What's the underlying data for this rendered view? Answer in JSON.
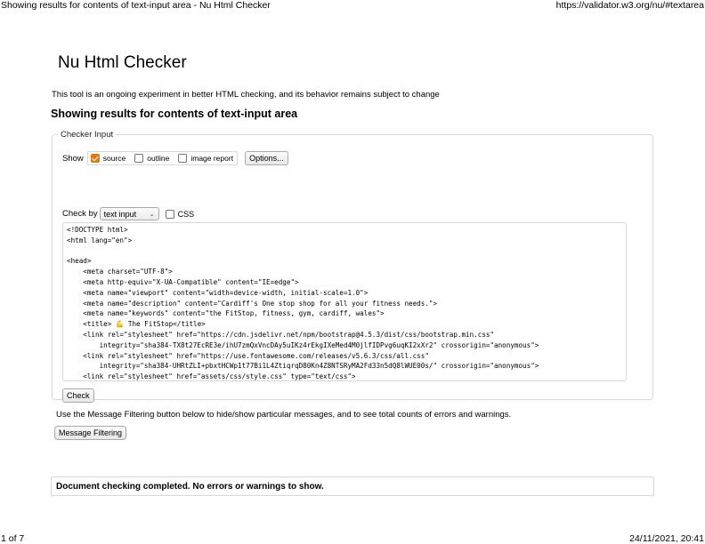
{
  "print_header": {
    "title": "Showing results for contents of text-input area - Nu Html Checker",
    "url": "https://validator.w3.org/nu/#textarea"
  },
  "print_footer": {
    "page": "1 of 7",
    "datetime": "24/11/2021, 20:41"
  },
  "page_title": "Nu Html Checker",
  "intro_text": "This tool is an ongoing experiment in better HTML checking, and its behavior remains subject to change",
  "results_heading": "Showing results for contents of text-input area",
  "checker_input": {
    "legend": "Checker Input",
    "show_label": "Show",
    "show_options": [
      {
        "label": "source",
        "checked": true
      },
      {
        "label": "outline",
        "checked": false
      },
      {
        "label": "image report",
        "checked": false
      }
    ],
    "options_button": "Options...",
    "check_by_label": "Check by",
    "check_by_selected": "text input",
    "css_label": "CSS",
    "css_checked": false,
    "code_lines": [
      "<!DOCTYPE html>",
      "<html lang=\"en\">",
      "",
      "<head>",
      "    <meta charset=\"UTF-8\">",
      "    <meta http-equiv=\"X-UA-Compatible\" content=\"IE=edge\">",
      "    <meta name=\"viewport\" content=\"width=device-width, initial-scale=1.0\">",
      "    <meta name=\"description\" content=\"Cardiff's One stop shop for all your fitness needs.\">",
      "    <meta name=\"keywords\" content=\"the FitStop, fitness, gym, cardiff, wales\">",
      "    <title> 💪 The FitStop</title>",
      "    <link rel=\"stylesheet\" href=\"https://cdn.jsdelivr.net/npm/bootstrap@4.5.3/dist/css/bootstrap.min.css\"",
      "        integrity=\"sha384-TX8t27EcRE3e/ihU7zmQxVncDAy5uIKz4rEkgIXeMed4M0jlfIDPvg6uqKI2xXr2\" crossorigin=\"anonymous\">",
      "    <link rel=\"stylesheet\" href=\"https://use.fontawesome.com/releases/v5.6.3/css/all.css\"",
      "        integrity=\"sha384-UHRtZLI+pbxtHCWp1t77Bi1L4ZtiqrqD80Kn4Z8NTSRyMA2Fd33n5dQ8lWUE00s/\" crossorigin=\"anonymous\">",
      "    <link rel=\"stylesheet\" href=\"assets/css/style.css\" type=\"text/css\">"
    ],
    "check_button": "Check"
  },
  "filter_note": "Use the Message Filtering button below to hide/show particular messages, and to see total counts of errors and warnings.",
  "filter_button": "Message Filtering",
  "result_message": "Document checking completed. No errors or warnings to show.",
  "colors": {
    "accent_checkbox": "#e07a12",
    "border": "#d8d8d8"
  }
}
